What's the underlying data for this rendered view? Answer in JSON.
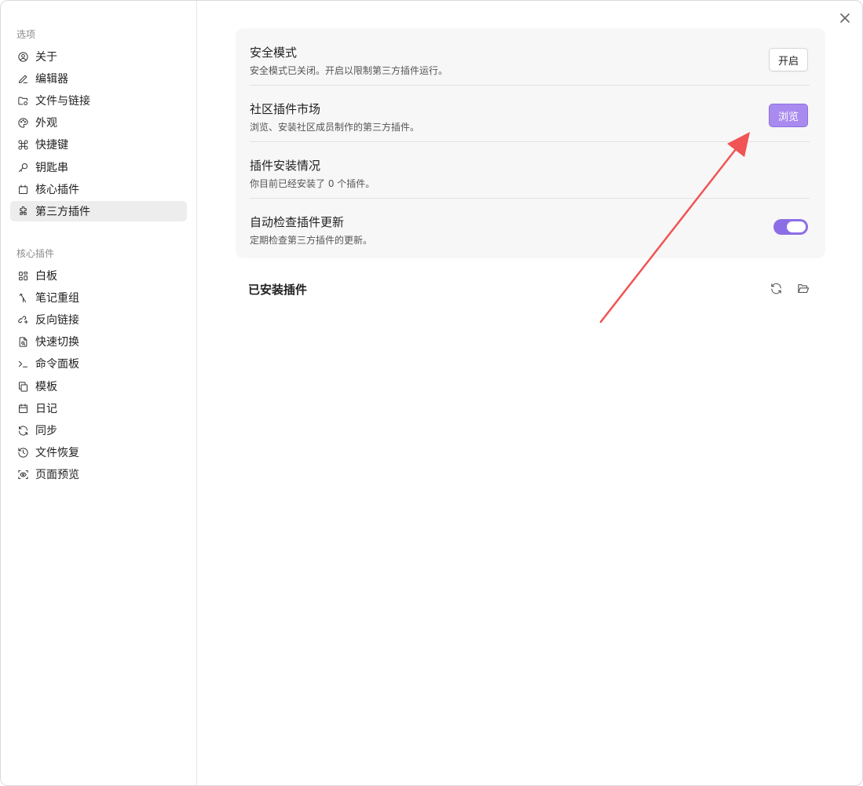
{
  "sidebar": {
    "section1_title": "选项",
    "options": [
      {
        "label": "关于",
        "icon": "user-circle-icon"
      },
      {
        "label": "编辑器",
        "icon": "pencil-icon"
      },
      {
        "label": "文件与链接",
        "icon": "folder-cog-icon"
      },
      {
        "label": "外观",
        "icon": "palette-icon"
      },
      {
        "label": "快捷键",
        "icon": "command-icon"
      },
      {
        "label": "钥匙串",
        "icon": "key-icon"
      },
      {
        "label": "核心插件",
        "icon": "calendar-box-icon"
      },
      {
        "label": "第三方插件",
        "icon": "puzzle-icon",
        "active": true
      }
    ],
    "section2_title": "核心插件",
    "core_plugins": [
      {
        "label": "白板",
        "icon": "grid-icon"
      },
      {
        "label": "笔记重组",
        "icon": "merge-icon"
      },
      {
        "label": "反向链接",
        "icon": "backlink-icon"
      },
      {
        "label": "快速切换",
        "icon": "file-search-icon"
      },
      {
        "label": "命令面板",
        "icon": "terminal-icon"
      },
      {
        "label": "模板",
        "icon": "copy-icon"
      },
      {
        "label": "日记",
        "icon": "calendar-icon"
      },
      {
        "label": "同步",
        "icon": "refresh-icon"
      },
      {
        "label": "文件恢复",
        "icon": "history-icon"
      },
      {
        "label": "页面预览",
        "icon": "eye-scan-icon"
      }
    ]
  },
  "settings": {
    "safe_mode": {
      "title": "安全模式",
      "desc": "安全模式已关闭。开启以限制第三方插件运行。",
      "button": "开启"
    },
    "community": {
      "title": "社区插件市场",
      "desc": "浏览、安装社区成员制作的第三方插件。",
      "button": "浏览"
    },
    "installed_status": {
      "title": "插件安装情况",
      "desc": "你目前已经安装了 0 个插件。"
    },
    "auto_update": {
      "title": "自动检查插件更新",
      "desc": "定期检查第三方插件的更新。",
      "enabled": true
    }
  },
  "installed": {
    "title": "已安装插件"
  },
  "colors": {
    "accent": "#8b6ee6",
    "arrow": "#f05454"
  }
}
